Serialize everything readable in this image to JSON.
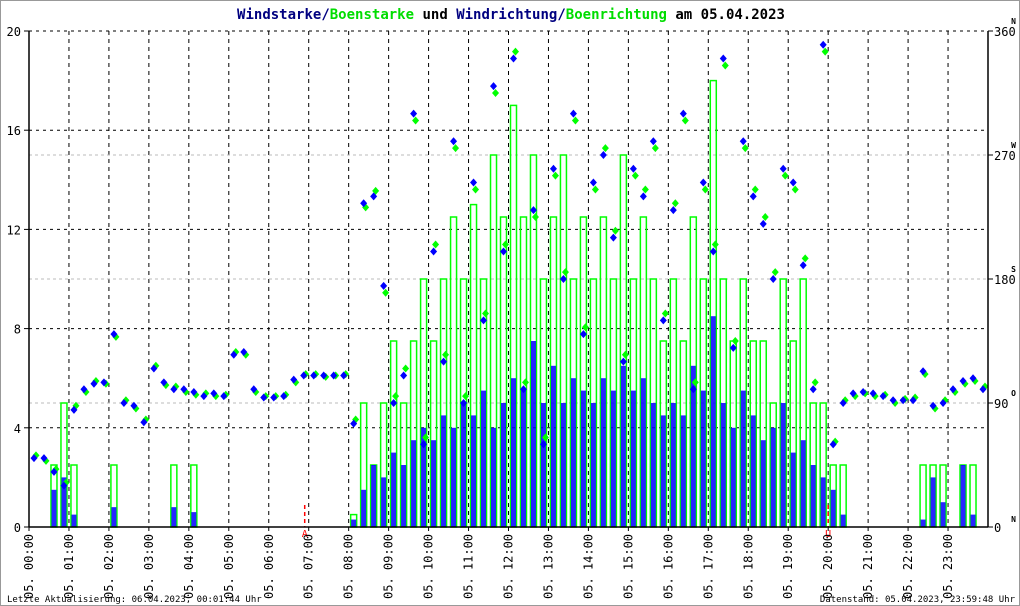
{
  "title": {
    "part1": "Windstarke/",
    "part2": "Boenstarke",
    "part3": " und ",
    "part4": "Windrichtung/",
    "part5": "Boenrichtung",
    "part6": " am 05.04.2023"
  },
  "footer": {
    "last_update": "Letzte Aktualisierung: 06.04.2023, 00:01:44 Uhr",
    "data_state": "Datenstand: 05.04.2023, 23:59:48 Uhr"
  },
  "sun_markers": {
    "sunrise": {
      "label": "A",
      "hour": 6.9
    },
    "sunset": {
      "label": "U",
      "hour": 20.0
    }
  },
  "colors": {
    "wind": "#0000ff",
    "gust": "#00ff00",
    "title_wind": "#000080",
    "sun": "#ff0000"
  },
  "chart_data": {
    "type": "line",
    "title": "Windstarke/Boenstarke und Windrichtung/Boenrichtung am 05.04.2023",
    "xlabel": "",
    "ylabel_left": "Windstarke",
    "ylabel_right": "Windrichtung",
    "xlim_hours": [
      0,
      24
    ],
    "ylim_left": [
      0,
      20
    ],
    "ylim_right": [
      0,
      360
    ],
    "left_ticks": [
      "0",
      "4",
      "8",
      "12",
      "16",
      "20"
    ],
    "right_ticks": [
      "0",
      "90",
      "180",
      "270",
      "360"
    ],
    "compass_labels": [
      "N",
      "O",
      "S",
      "W",
      "N"
    ],
    "x_tick_labels": [
      "05. 00:00",
      "05. 01:00",
      "05. 02:00",
      "05. 03:00",
      "05. 04:00",
      "05. 05:00",
      "05. 06:00",
      "05. 07:00",
      "05. 08:00",
      "05. 09:00",
      "05. 10:00",
      "05. 11:00",
      "05. 12:00",
      "05. 13:00",
      "05. 14:00",
      "05. 15:00",
      "05. 16:00",
      "05. 17:00",
      "05. 18:00",
      "05. 19:00",
      "05. 20:00",
      "05. 21:00",
      "05. 22:00",
      "05. 23:00"
    ],
    "grid": true,
    "interval_minutes": 15,
    "series": [
      {
        "name": "Windstarke",
        "axis": "left",
        "values": [
          0,
          0,
          1.5,
          2.0,
          0.5,
          0,
          0,
          0,
          0.8,
          0,
          0,
          0,
          0,
          0,
          0.8,
          0,
          0.6,
          0,
          0,
          0,
          0,
          0,
          0,
          0,
          0,
          0,
          0,
          0,
          0,
          0,
          0,
          0,
          0.3,
          1.5,
          2.5,
          2.0,
          3.0,
          2.5,
          3.5,
          4.0,
          3.5,
          4.5,
          4.0,
          5.0,
          4.5,
          5.5,
          4.0,
          5.0,
          6.0,
          5.5,
          7.5,
          5.0,
          6.5,
          5.0,
          6.0,
          5.5,
          5.0,
          6.0,
          5.5,
          6.5,
          5.5,
          6.0,
          5.0,
          4.5,
          5.0,
          4.5,
          6.5,
          5.5,
          8.5,
          5.0,
          4.0,
          5.5,
          4.5,
          3.5,
          4.0,
          5.0,
          3.0,
          3.5,
          2.5,
          2.0,
          1.5,
          0.5,
          0,
          0,
          0,
          0,
          0,
          0,
          0,
          0.3,
          2.0,
          1.0,
          0,
          2.5,
          0.5,
          0
        ]
      },
      {
        "name": "Boenstarke",
        "axis": "left",
        "values": [
          0,
          0,
          2.5,
          5.0,
          2.5,
          0,
          0,
          0,
          2.5,
          0,
          0,
          0,
          0,
          0,
          2.5,
          0,
          2.5,
          0,
          0,
          0,
          0,
          0,
          0,
          0,
          0,
          0,
          0,
          0,
          0,
          0,
          0,
          0,
          0.5,
          5.0,
          2.5,
          5.0,
          7.5,
          5.0,
          7.5,
          10.0,
          7.5,
          10.0,
          12.5,
          10.0,
          13.0,
          10.0,
          15.0,
          12.5,
          17.0,
          12.5,
          15.0,
          10.0,
          12.5,
          15.0,
          10.0,
          12.5,
          10.0,
          12.5,
          10.0,
          15.0,
          10.0,
          12.5,
          10.0,
          7.5,
          10.0,
          7.5,
          12.5,
          10.0,
          18.0,
          10.0,
          7.5,
          10.0,
          7.5,
          7.5,
          5.0,
          10.0,
          7.5,
          10.0,
          5.0,
          5.0,
          2.5,
          2.5,
          0,
          0,
          0,
          0,
          0,
          0,
          0,
          2.5,
          2.5,
          2.5,
          0,
          2.5,
          2.5,
          0
        ]
      },
      {
        "name": "Windrichtung",
        "axis": "right",
        "values": [
          50,
          50,
          40,
          30,
          85,
          100,
          104,
          105,
          140,
          90,
          88,
          76,
          115,
          105,
          100,
          100,
          98,
          95,
          97,
          95,
          125,
          127,
          100,
          94,
          94,
          95,
          107,
          110,
          110,
          110,
          110,
          110,
          75,
          235,
          240,
          175,
          90,
          110,
          300,
          60,
          200,
          120,
          280,
          90,
          250,
          150,
          320,
          200,
          340,
          100,
          230,
          60,
          260,
          180,
          300,
          140,
          250,
          270,
          210,
          120,
          260,
          240,
          280,
          150,
          230,
          300,
          100,
          250,
          200,
          340,
          130,
          280,
          240,
          220,
          180,
          260,
          250,
          190,
          100,
          350,
          60,
          90,
          97,
          98,
          97,
          95,
          92,
          92,
          92,
          113,
          88,
          90,
          100,
          106,
          108,
          100
        ]
      },
      {
        "name": "Boenrichtung",
        "axis": "right",
        "values": [
          52,
          48,
          42,
          32,
          88,
          98,
          106,
          104,
          138,
          92,
          86,
          78,
          117,
          103,
          102,
          98,
          96,
          97,
          95,
          96,
          127,
          125,
          98,
          95,
          95,
          96,
          105,
          111,
          111,
          109,
          110,
          111,
          78,
          232,
          244,
          170,
          95,
          115,
          295,
          65,
          205,
          125,
          275,
          95,
          245,
          155,
          315,
          205,
          345,
          105,
          225,
          65,
          255,
          185,
          295,
          145,
          245,
          275,
          215,
          125,
          255,
          245,
          275,
          155,
          235,
          295,
          105,
          245,
          205,
          335,
          135,
          275,
          245,
          225,
          185,
          255,
          245,
          195,
          105,
          345,
          62,
          92,
          95,
          97,
          95,
          96,
          90,
          93,
          94,
          111,
          86,
          92,
          98,
          104,
          106,
          102
        ]
      }
    ]
  }
}
